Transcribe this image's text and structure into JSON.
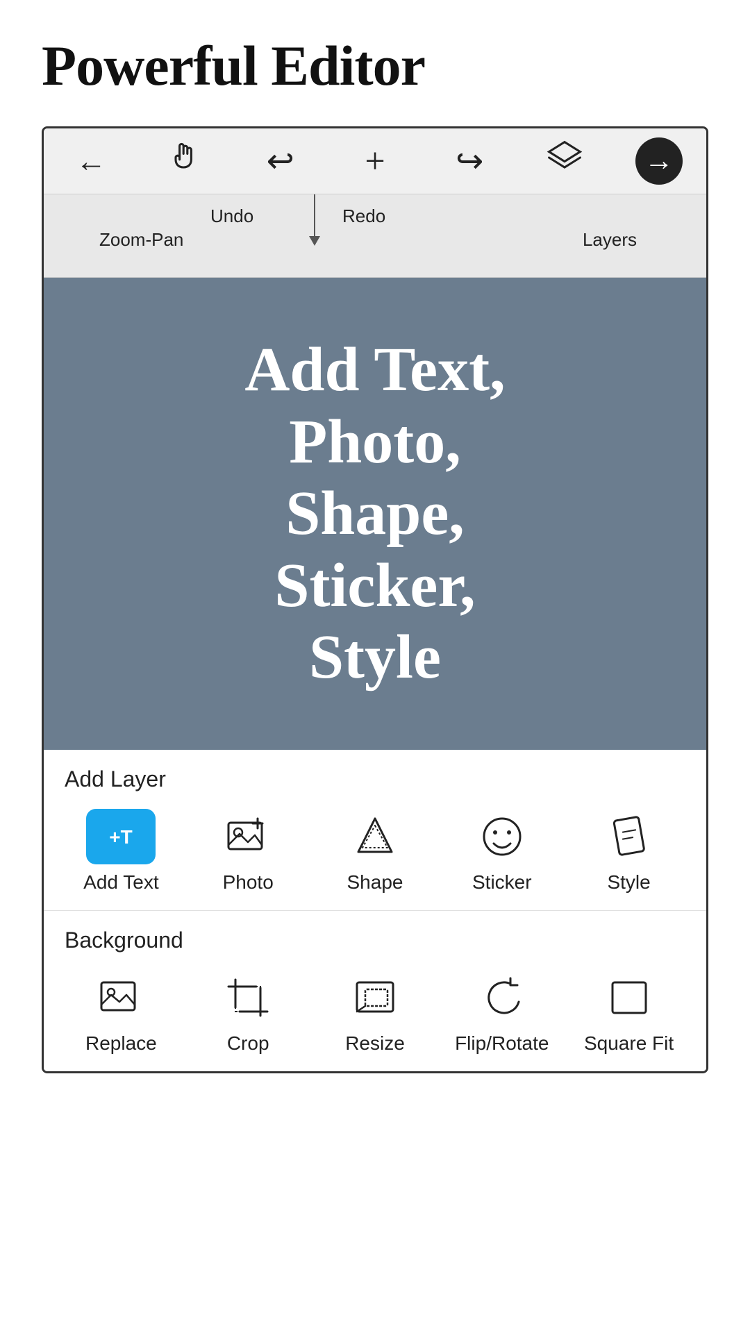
{
  "page": {
    "title": "Powerful Editor"
  },
  "toolbar": {
    "items": [
      {
        "id": "back",
        "icon": "←",
        "label": "Back"
      },
      {
        "id": "zoom-pan",
        "icon": "✋",
        "label": "Zoom-Pan"
      },
      {
        "id": "undo",
        "icon": "↩",
        "label": "Undo"
      },
      {
        "id": "add",
        "icon": "+",
        "label": "Add"
      },
      {
        "id": "redo",
        "icon": "↪",
        "label": "Redo"
      },
      {
        "id": "layers",
        "icon": "◈",
        "label": "Layers"
      },
      {
        "id": "next",
        "icon": "→",
        "label": "Next",
        "active": true
      }
    ]
  },
  "tooltips": {
    "zoom_pan": "Zoom-Pan",
    "undo": "Undo",
    "redo": "Redo",
    "layers": "Layers"
  },
  "canvas": {
    "text": "Add Text,\nPhoto,\nShape,\nSticker,\nStyle"
  },
  "add_layer": {
    "section_label": "Add Layer",
    "tools": [
      {
        "id": "add-text",
        "label": "Add Text",
        "active": true
      },
      {
        "id": "photo",
        "label": "Photo"
      },
      {
        "id": "shape",
        "label": "Shape"
      },
      {
        "id": "sticker",
        "label": "Sticker"
      },
      {
        "id": "style",
        "label": "Style"
      }
    ]
  },
  "background": {
    "section_label": "Background",
    "tools": [
      {
        "id": "replace",
        "label": "Replace"
      },
      {
        "id": "crop",
        "label": "Crop"
      },
      {
        "id": "resize",
        "label": "Resize"
      },
      {
        "id": "flip-rotate",
        "label": "Flip/Rotate"
      },
      {
        "id": "square-fit",
        "label": "Square Fit"
      }
    ]
  }
}
